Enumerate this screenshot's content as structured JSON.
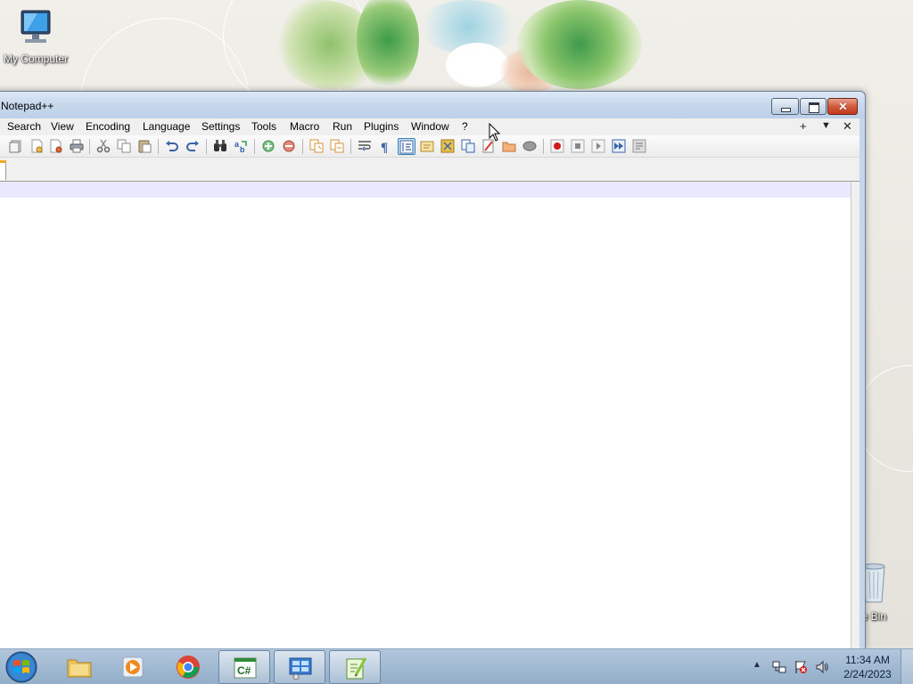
{
  "desktop": {
    "icons": [
      {
        "label": "My Computer",
        "icon": "computer-icon"
      },
      {
        "label": "cle Bin",
        "icon": "recycle-bin-icon"
      }
    ]
  },
  "window": {
    "title": "Notepad++",
    "menus": [
      "Search",
      "View",
      "Encoding",
      "Language",
      "Settings",
      "Tools",
      "Macro",
      "Run",
      "Plugins",
      "Window",
      "?"
    ],
    "menu_right": [
      "+",
      "▼",
      "✕"
    ],
    "toolbar_icons": [
      "close-all-icon",
      "save-icon",
      "save-all-icon",
      "print-icon",
      "cut-icon",
      "copy-icon",
      "paste-icon",
      "undo-icon",
      "redo-icon",
      "find-icon",
      "replace-icon",
      "zoom-in-icon",
      "zoom-out-icon",
      "sync-vertical-icon",
      "sync-horizontal-icon",
      "word-wrap-icon",
      "show-all-chars-icon",
      "indent-guide-icon",
      "user-defined-language-icon",
      "document-map-icon",
      "document-list-icon",
      "function-list-icon",
      "folder-workspace-icon",
      "monitoring-icon",
      "record-macro-icon",
      "stop-macro-icon",
      "play-macro-icon",
      "run-macro-multiple-icon",
      "save-macro-icon"
    ],
    "active_tool": "indent-guide-icon"
  },
  "taskbar": {
    "start_label": "Start",
    "apps": [
      {
        "name": "file-explorer",
        "icon": "folder-icon",
        "running": false
      },
      {
        "name": "media-player",
        "icon": "media-player-icon",
        "running": false
      },
      {
        "name": "chrome",
        "icon": "chrome-icon",
        "running": false
      },
      {
        "name": "csharp-app",
        "icon": "csharp-icon",
        "running": true
      },
      {
        "name": "control-panel",
        "icon": "control-panel-icon",
        "running": true
      },
      {
        "name": "notepad-plus-plus",
        "icon": "notepad-plus-plus-icon",
        "running": true
      }
    ],
    "tray_icons": [
      "show-hidden-icons-arrow",
      "network-icon",
      "action-center-icon",
      "volume-icon"
    ],
    "time": "11:34 AM",
    "date": "2/24/2023"
  },
  "colors": {
    "taskbar": "#a3bbd3",
    "current_line_highlight": "#e8e8ff",
    "close_button": "#d35b3e",
    "title_bar": "#c7d8ec"
  }
}
